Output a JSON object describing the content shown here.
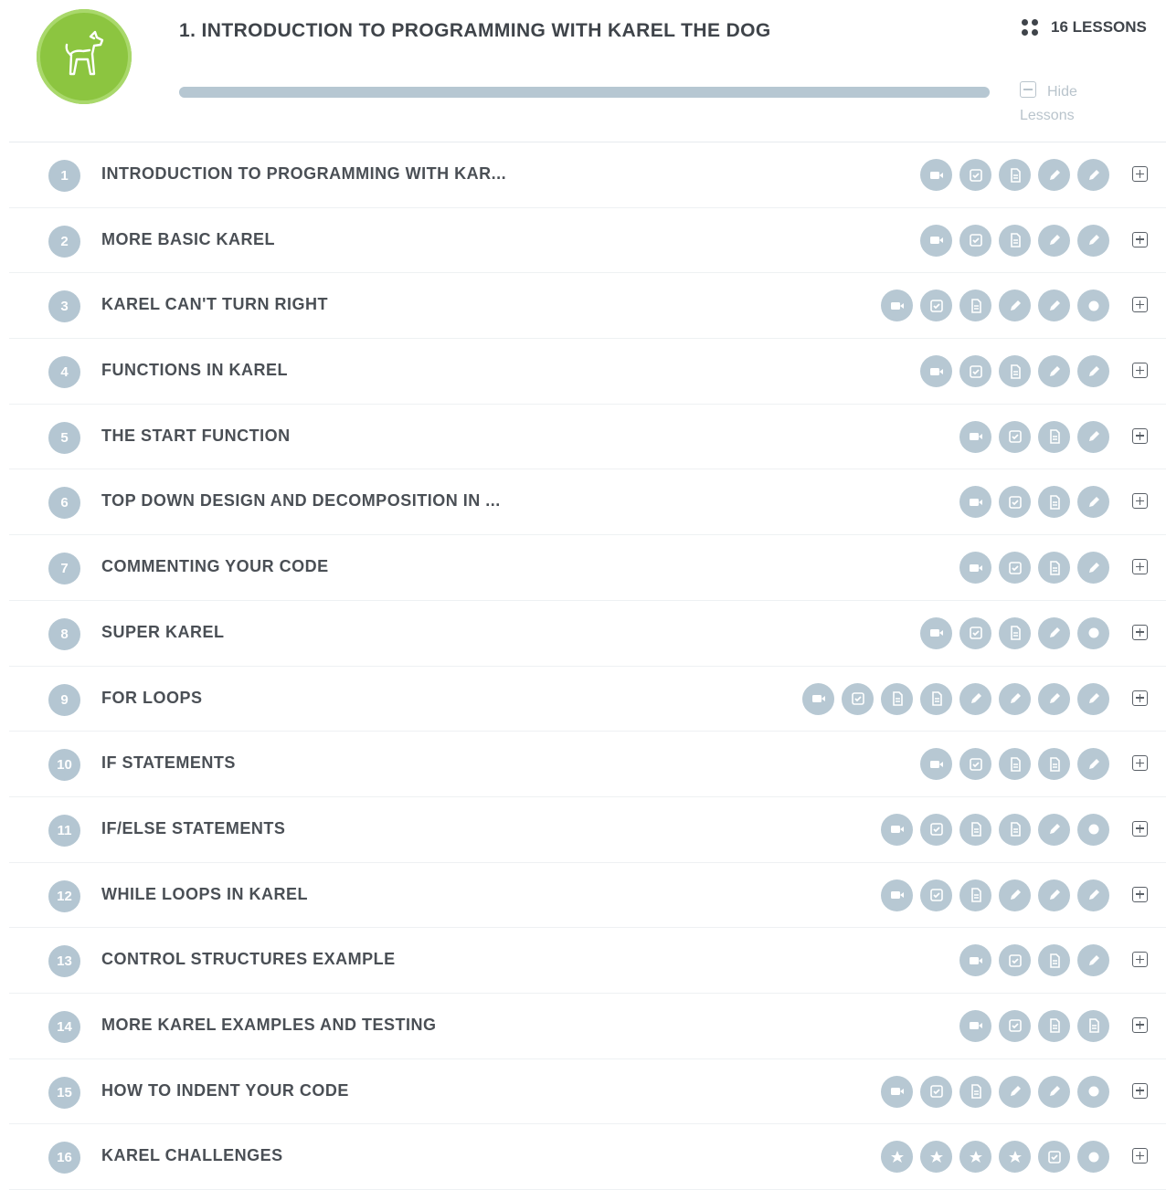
{
  "module": {
    "title": "1. INTRODUCTION TO PROGRAMMING WITH KAREL THE DOG",
    "lesson_count": "16 LESSONS",
    "hide_lessons_label": "Hide Lessons",
    "progress_fraction": 1.0,
    "badge_color": "#8cc540",
    "badge_icon": "dog-icon"
  },
  "lessons": [
    {
      "number": "1",
      "title": "INTRODUCTION TO PROGRAMMING WITH KAR...",
      "activities": [
        "video",
        "check",
        "doc",
        "pencil",
        "pencil"
      ]
    },
    {
      "number": "2",
      "title": "MORE BASIC KAREL",
      "activities": [
        "video",
        "check",
        "doc",
        "pencil",
        "pencil"
      ]
    },
    {
      "number": "3",
      "title": "KAREL CAN'T TURN RIGHT",
      "activities": [
        "video",
        "check",
        "doc",
        "pencil",
        "pencil",
        "circle"
      ]
    },
    {
      "number": "4",
      "title": "FUNCTIONS IN KAREL",
      "activities": [
        "video",
        "check",
        "doc",
        "pencil",
        "pencil"
      ]
    },
    {
      "number": "5",
      "title": "THE START FUNCTION",
      "activities": [
        "video",
        "check",
        "doc",
        "pencil"
      ]
    },
    {
      "number": "6",
      "title": "TOP DOWN DESIGN AND DECOMPOSITION IN ...",
      "activities": [
        "video",
        "check",
        "doc",
        "pencil"
      ]
    },
    {
      "number": "7",
      "title": "COMMENTING YOUR CODE",
      "activities": [
        "video",
        "check",
        "doc",
        "pencil"
      ]
    },
    {
      "number": "8",
      "title": "SUPER KAREL",
      "activities": [
        "video",
        "check",
        "doc",
        "pencil",
        "circle"
      ]
    },
    {
      "number": "9",
      "title": "FOR LOOPS",
      "activities": [
        "video",
        "check",
        "doc",
        "doc",
        "pencil",
        "pencil",
        "pencil",
        "pencil"
      ]
    },
    {
      "number": "10",
      "title": "IF STATEMENTS",
      "activities": [
        "video",
        "check",
        "doc",
        "doc",
        "pencil"
      ]
    },
    {
      "number": "11",
      "title": "IF/ELSE STATEMENTS",
      "activities": [
        "video",
        "check",
        "doc",
        "doc",
        "pencil",
        "circle"
      ]
    },
    {
      "number": "12",
      "title": "WHILE LOOPS IN KAREL",
      "activities": [
        "video",
        "check",
        "doc",
        "pencil",
        "pencil",
        "pencil"
      ]
    },
    {
      "number": "13",
      "title": "CONTROL STRUCTURES EXAMPLE",
      "activities": [
        "video",
        "check",
        "doc",
        "pencil"
      ]
    },
    {
      "number": "14",
      "title": "MORE KAREL EXAMPLES AND TESTING",
      "activities": [
        "video",
        "check",
        "doc",
        "doc"
      ]
    },
    {
      "number": "15",
      "title": "HOW TO INDENT YOUR CODE",
      "activities": [
        "video",
        "check",
        "doc",
        "pencil",
        "pencil",
        "circle"
      ]
    },
    {
      "number": "16",
      "title": "KAREL CHALLENGES",
      "activities": [
        "star",
        "star",
        "star",
        "star",
        "check",
        "circle"
      ]
    }
  ],
  "colors": {
    "activity_bg": "#b7c8d3",
    "number_bg": "#b4c6d2",
    "text": "#4a4f55"
  }
}
